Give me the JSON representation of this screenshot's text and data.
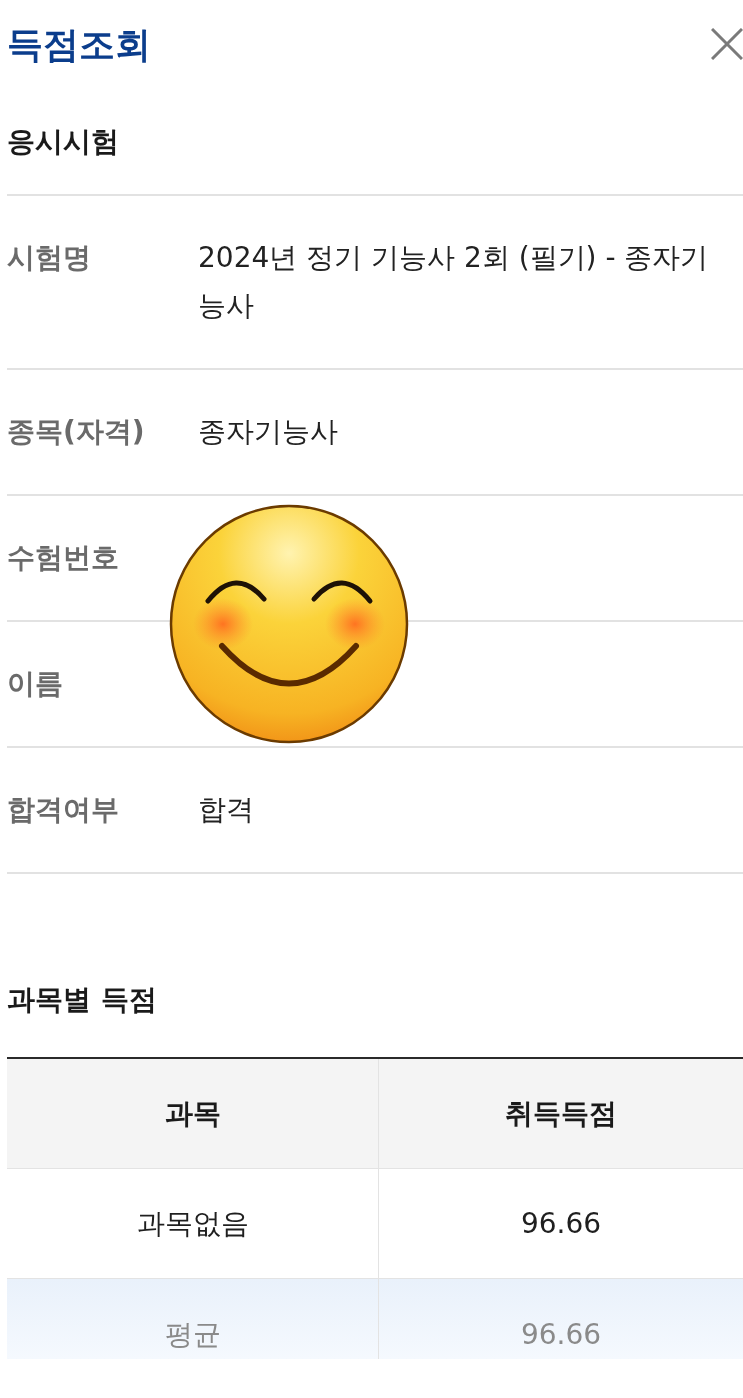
{
  "header": {
    "title": "득점조회"
  },
  "exam_section": {
    "title": "응시시험",
    "rows": [
      {
        "label": "시험명",
        "value": "2024년 정기 기능사 2회 (필기) - 종자기능사"
      },
      {
        "label": "종목(자격)",
        "value": "종자기능사"
      },
      {
        "label": "수험번호"
      },
      {
        "label": "이름"
      },
      {
        "label": "합격여부",
        "value": "합격"
      }
    ]
  },
  "score_section": {
    "title": "과목별 득점",
    "table": {
      "columns": [
        "과목",
        "취득득점"
      ],
      "rows": [
        {
          "kind": "data",
          "cells": [
            "과목없음",
            "96.66"
          ]
        },
        {
          "kind": "average",
          "cells": [
            "평균",
            "96.66"
          ]
        }
      ]
    }
  }
}
